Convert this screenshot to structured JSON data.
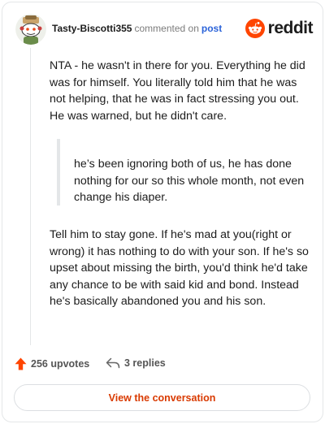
{
  "comment": {
    "username": "Tasty-Biscotti355",
    "action_text": "commented on",
    "post_link": "post",
    "brand": "reddit",
    "paragraph_1": "NTA - he wasn't in there for you. Everything he did was for himself. You literally told him that he was not helping, that he was in fact stressing you out. He was warned, but he didn't care.",
    "quote": "he’s been ignoring both of us, he has done nothing for our so this whole month, not even change his diaper.",
    "paragraph_2": "Tell him to stay gone. If he's mad at you(right or wrong) it has nothing to do with your son. If he's so upset about missing the birth, you'd think he'd take any chance to be with said kid and bond. Instead he's basically abandoned you and his son."
  },
  "footer": {
    "upvotes": "256 upvotes",
    "replies": "3 replies",
    "view_button": "View the conversation"
  },
  "icons": {
    "avatar": "snoo-avatar-icon",
    "brand_logo": "reddit-logo-icon",
    "upvote": "upvote-arrow-icon",
    "reply": "reply-arrow-icon"
  },
  "colors": {
    "accent": "#ff4500",
    "link": "#2b63d9",
    "button_text": "#d93a00",
    "upvote": "#ff4500"
  }
}
